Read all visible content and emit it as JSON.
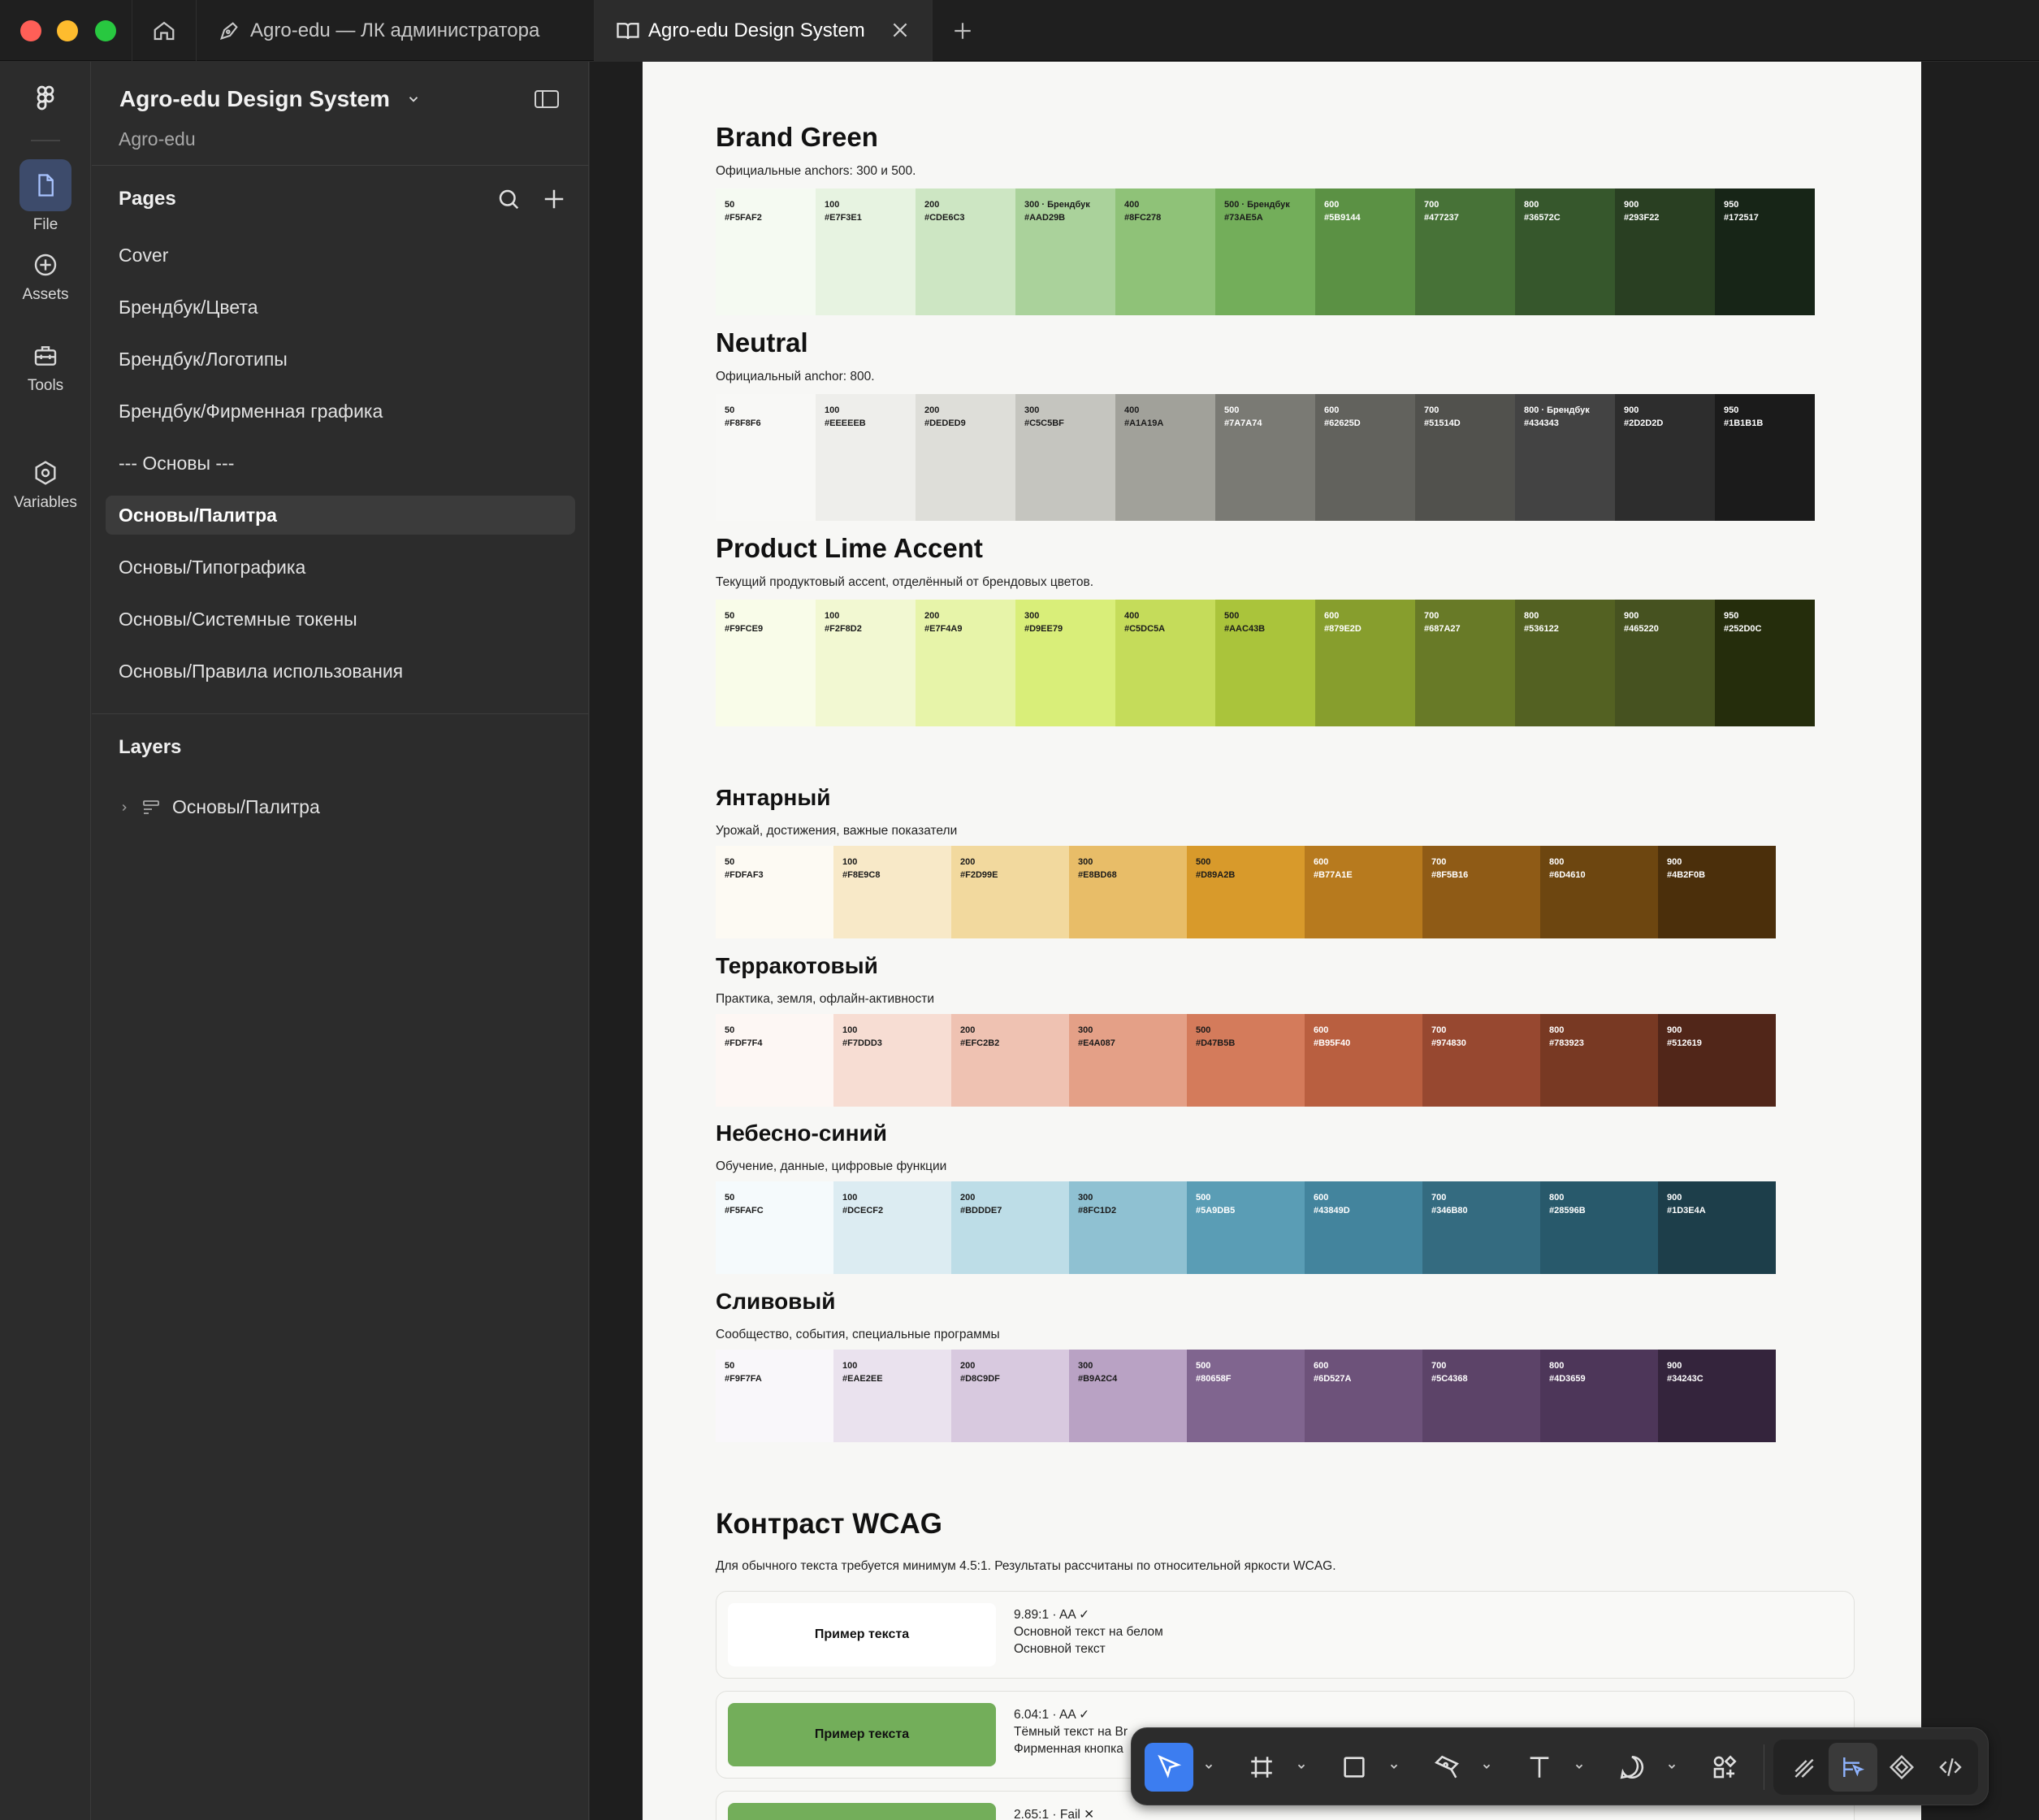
{
  "tabs": [
    {
      "label": "Agro-edu — ЛК администратора"
    },
    {
      "label": "Agro-edu Design System"
    }
  ],
  "rail": [
    {
      "label": "File",
      "icon": "file-icon"
    },
    {
      "label": "Assets",
      "icon": "plus-circle-icon"
    },
    {
      "label": "Tools",
      "icon": "toolbox-icon"
    },
    {
      "label": "Variables",
      "icon": "variables-icon"
    }
  ],
  "panel": {
    "file_title": "Agro-edu Design System",
    "file_subtitle": "Agro-edu",
    "pages_heading": "Pages",
    "pages": [
      "Cover",
      "Брендбук/Цвета",
      "Брендбук/Логотипы",
      "Брендбук/Фирменная графика",
      "--- Основы ---",
      "Основы/Палитра",
      "Основы/Типографика",
      "Основы/Системные токены",
      "Основы/Правила использования"
    ],
    "active_page": "Основы/Палитра",
    "layers_heading": "Layers",
    "layer": "Основы/Палитра"
  },
  "palettes": [
    {
      "title": "Brand Green",
      "desc": "Официальные anchors: 300 и 500.",
      "size": "lg",
      "swatches": [
        [
          "50",
          "#F5FAF2"
        ],
        [
          "100",
          "#E7F3E1"
        ],
        [
          "200",
          "#CDE6C3"
        ],
        [
          "300 · Брендбук",
          "#AAD29B"
        ],
        [
          "400",
          "#8FC278"
        ],
        [
          "500 · Брендбук",
          "#73AE5A"
        ],
        [
          "600",
          "#5B9144"
        ],
        [
          "700",
          "#477237"
        ],
        [
          "800",
          "#36572C"
        ],
        [
          "900",
          "#293F22"
        ],
        [
          "950",
          "#172517"
        ]
      ]
    },
    {
      "title": "Neutral",
      "desc": "Официальный anchor: 800.",
      "size": "lg",
      "swatches": [
        [
          "50",
          "#F8F8F6"
        ],
        [
          "100",
          "#EEEEEB"
        ],
        [
          "200",
          "#DEDED9"
        ],
        [
          "300",
          "#C5C5BF"
        ],
        [
          "400",
          "#A1A19A"
        ],
        [
          "500",
          "#7A7A74"
        ],
        [
          "600",
          "#62625D"
        ],
        [
          "700",
          "#51514D"
        ],
        [
          "800 · Брендбук",
          "#434343"
        ],
        [
          "900",
          "#2D2D2D"
        ],
        [
          "950",
          "#1B1B1B"
        ]
      ]
    },
    {
      "title": "Product Lime Accent",
      "desc": "Текущий продуктовый accent, отделённый от брендовых цветов.",
      "size": "lg",
      "swatches": [
        [
          "50",
          "#F9FCE9"
        ],
        [
          "100",
          "#F2F8D2"
        ],
        [
          "200",
          "#E7F4A9"
        ],
        [
          "300",
          "#D9EE79"
        ],
        [
          "400",
          "#C5DC5A"
        ],
        [
          "500",
          "#AAC43B"
        ],
        [
          "600",
          "#879E2D"
        ],
        [
          "700",
          "#687A27"
        ],
        [
          "800",
          "#536122"
        ],
        [
          "900",
          "#465220"
        ],
        [
          "950",
          "#252D0C"
        ]
      ]
    },
    {
      "title": "Янтарный",
      "desc": "Урожай, достижения, важные показатели",
      "size": "md",
      "swatches": [
        [
          "50",
          "#FDFAF3"
        ],
        [
          "100",
          "#F8E9C8"
        ],
        [
          "200",
          "#F2D99E"
        ],
        [
          "300",
          "#E8BD68"
        ],
        [
          "500",
          "#D89A2B"
        ],
        [
          "600",
          "#B77A1E"
        ],
        [
          "700",
          "#8F5B16"
        ],
        [
          "800",
          "#6D4610"
        ],
        [
          "900",
          "#4B2F0B"
        ]
      ]
    },
    {
      "title": "Терракотовый",
      "desc": "Практика, земля, офлайн-активности",
      "size": "md",
      "swatches": [
        [
          "50",
          "#FDF7F4"
        ],
        [
          "100",
          "#F7DDD3"
        ],
        [
          "200",
          "#EFC2B2"
        ],
        [
          "300",
          "#E4A087"
        ],
        [
          "500",
          "#D47B5B"
        ],
        [
          "600",
          "#B95F40"
        ],
        [
          "700",
          "#974830"
        ],
        [
          "800",
          "#783923"
        ],
        [
          "900",
          "#512619"
        ]
      ]
    },
    {
      "title": "Небесно-синий",
      "desc": "Обучение, данные, цифровые функции",
      "size": "md",
      "swatches": [
        [
          "50",
          "#F5FAFC"
        ],
        [
          "100",
          "#DCECF2"
        ],
        [
          "200",
          "#BDDDE7"
        ],
        [
          "300",
          "#8FC1D2"
        ],
        [
          "500",
          "#5A9DB5"
        ],
        [
          "600",
          "#43849D"
        ],
        [
          "700",
          "#346B80"
        ],
        [
          "800",
          "#28596B"
        ],
        [
          "900",
          "#1D3E4A"
        ]
      ]
    },
    {
      "title": "Сливовый",
      "desc": "Сообщество, события, специальные программы",
      "size": "md",
      "swatches": [
        [
          "50",
          "#F9F7FA"
        ],
        [
          "100",
          "#EAE2EE"
        ],
        [
          "200",
          "#D8C9DF"
        ],
        [
          "300",
          "#B9A2C4"
        ],
        [
          "500",
          "#80658F"
        ],
        [
          "600",
          "#6D527A"
        ],
        [
          "700",
          "#5C4368"
        ],
        [
          "800",
          "#4D3659"
        ],
        [
          "900",
          "#34243C"
        ]
      ]
    }
  ],
  "contrast": {
    "title": "Контраст WCAG",
    "desc": "Для обычного текста требуется минимум 4.5:1. Результаты рассчитаны по относительной яркости WCAG.",
    "cards": [
      {
        "sample": "Пример текста",
        "bg": "#FFFFFF",
        "ratio": "9.89:1 · AA ✓",
        "line1": "Основной текст на белом",
        "line2": "Основной текст"
      },
      {
        "sample": "Пример текста",
        "bg": "#73AE5A",
        "ratio": "6.04:1 · AA ✓",
        "line1": "Тёмный текст на Br",
        "line2": "Фирменная кнопка"
      },
      {
        "sample": "",
        "bg": "#73AE5A",
        "ratio": "2.65:1 · Fail ✕",
        "line1": "",
        "line2": ""
      }
    ]
  },
  "toolbar": [
    "move-icon",
    "frame-icon",
    "rectangle-icon",
    "pen-icon",
    "text-icon",
    "comment-icon",
    "actions-icon",
    "draw-mode-icon",
    "design-mode-icon",
    "component-icon",
    "dev-mode-icon"
  ]
}
